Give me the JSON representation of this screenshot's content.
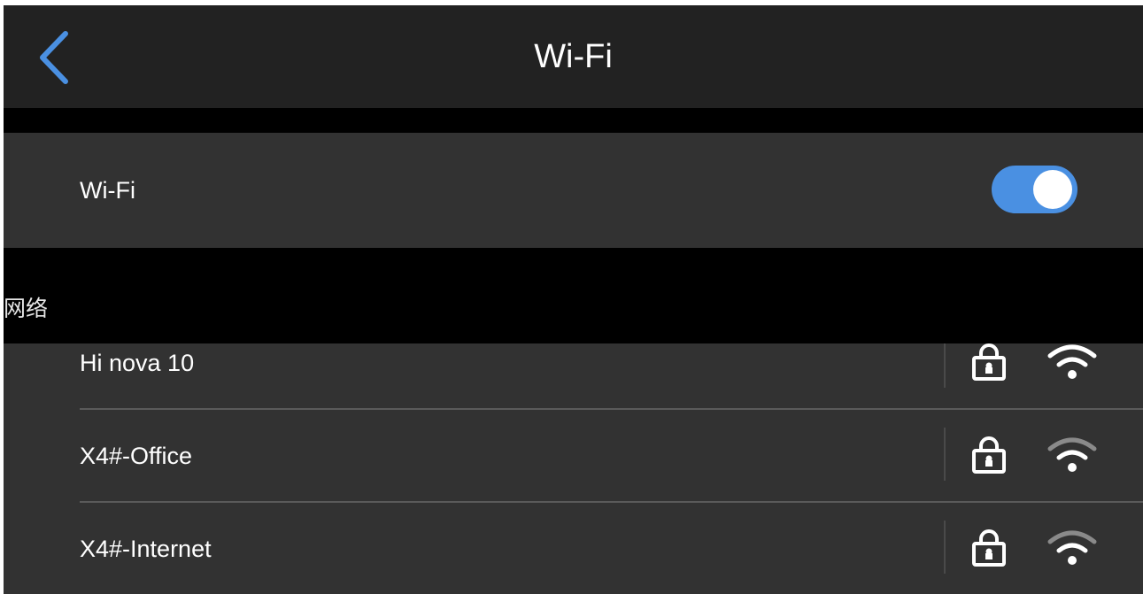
{
  "header": {
    "title": "Wi-Fi",
    "back_icon": "chevron-left-icon",
    "accent_color": "#4a90e2"
  },
  "wifi_setting": {
    "label": "Wi-Fi",
    "enabled": true,
    "toggle_color": "#4a90e2"
  },
  "networks": {
    "section_title": "网络",
    "items": [
      {
        "name": "Hi nova 10",
        "secured": true,
        "lock_icon": "lock-icon",
        "signal_icon": "wifi-signal-icon"
      },
      {
        "name": "X4#-Office",
        "secured": true,
        "lock_icon": "lock-icon",
        "signal_icon": "wifi-signal-icon"
      },
      {
        "name": "X4#-Internet",
        "secured": true,
        "lock_icon": "lock-icon",
        "signal_icon": "wifi-signal-icon"
      }
    ]
  }
}
